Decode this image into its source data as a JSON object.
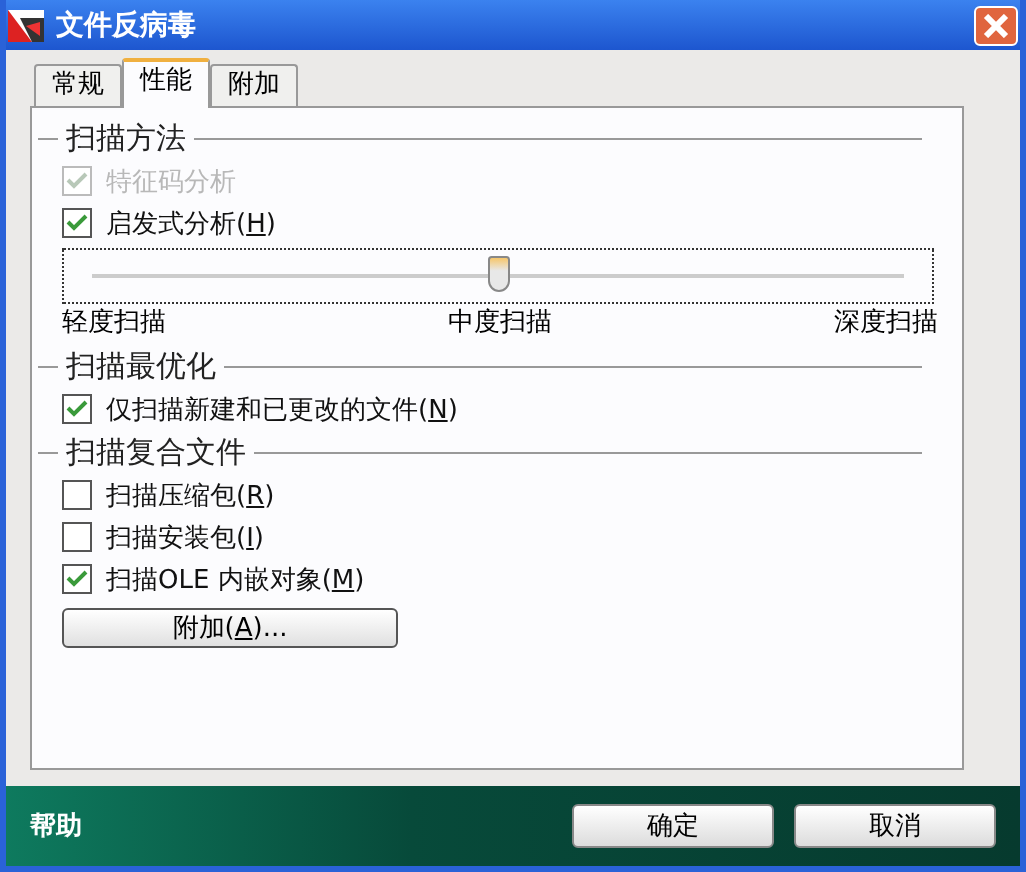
{
  "window": {
    "title": "文件反病毒"
  },
  "tabs": [
    {
      "label": "常规",
      "selected": false
    },
    {
      "label": "性能",
      "selected": true
    },
    {
      "label": "附加",
      "selected": false
    }
  ],
  "sections": [
    {
      "title": "扫描方法",
      "items": [
        {
          "kind": "checkbox",
          "text": "特征码分析",
          "checked": true,
          "disabled": true
        },
        {
          "kind": "checkbox",
          "text": "启发式分析(",
          "key": "H",
          "after": ")",
          "checked": true,
          "disabled": false
        },
        {
          "kind": "slider",
          "level": 0.5,
          "labels": [
            "轻度扫描",
            "中度扫描",
            "深度扫描"
          ]
        }
      ]
    },
    {
      "title": "扫描最优化",
      "items": [
        {
          "kind": "checkbox",
          "text": "仅扫描新建和已更改的文件(",
          "key": "N",
          "after": ")",
          "checked": true,
          "disabled": false
        }
      ]
    },
    {
      "title": "扫描复合文件",
      "items": [
        {
          "kind": "checkbox",
          "text": "扫描压缩包(",
          "key": "R",
          "after": ")",
          "checked": false,
          "disabled": false
        },
        {
          "kind": "checkbox",
          "text": "扫描安装包(",
          "key": "I",
          "after": ")",
          "checked": false,
          "disabled": false
        },
        {
          "kind": "checkbox",
          "text": "扫描OLE 内嵌对象(",
          "key": "M",
          "after": ")",
          "checked": true,
          "disabled": false
        },
        {
          "kind": "button",
          "text": "附加(",
          "key": "A",
          "after": ")..."
        }
      ]
    }
  ],
  "footer": {
    "help": "帮助",
    "buttons": [
      "确定",
      "取消"
    ]
  }
}
